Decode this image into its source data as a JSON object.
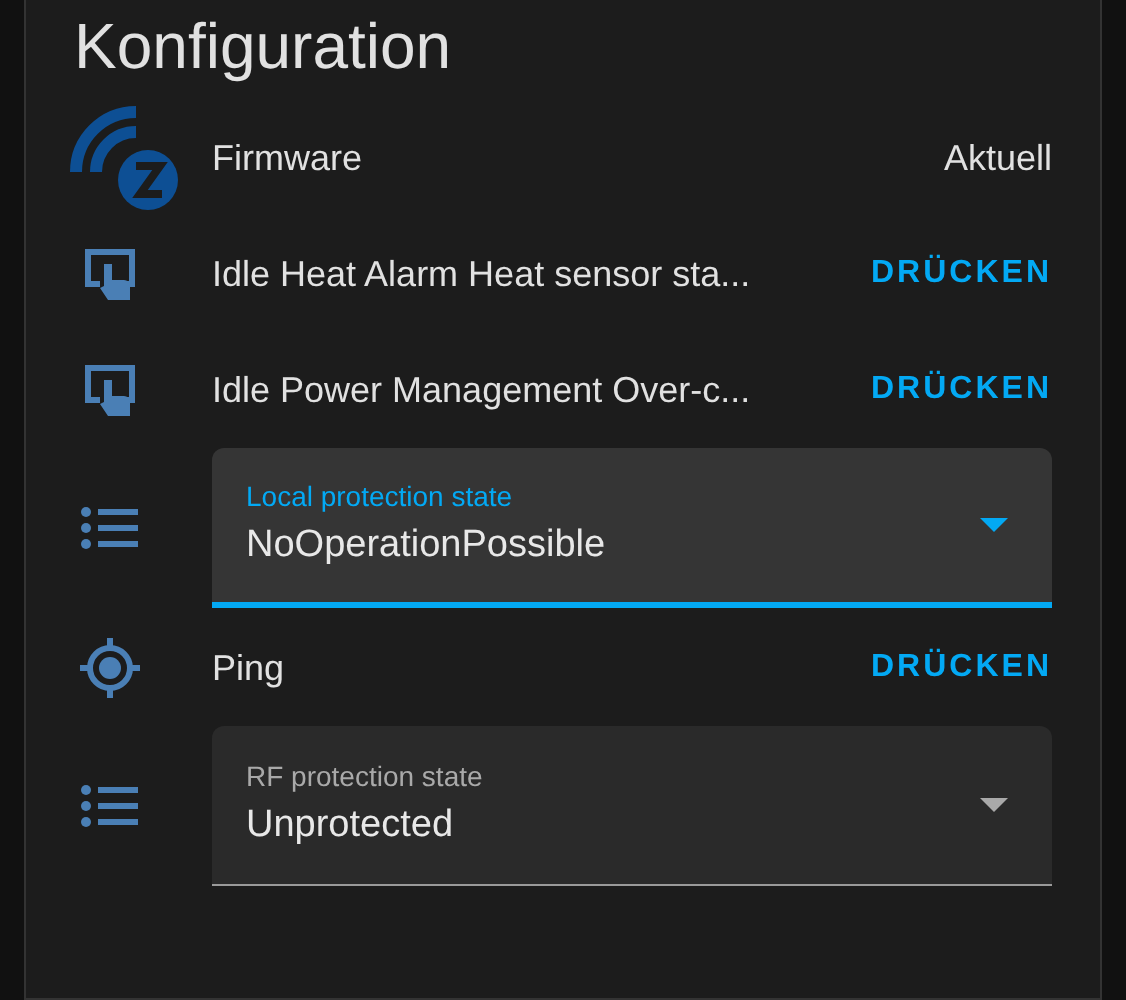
{
  "card": {
    "title": "Konfiguration"
  },
  "rows": [
    {
      "kind": "firmware",
      "label": "Firmware",
      "value": "Aktuell"
    },
    {
      "kind": "press",
      "label": "Idle Heat Alarm Heat sensor sta...",
      "action": "DRÜCKEN"
    },
    {
      "kind": "press",
      "label": "Idle Power Management Over-c...",
      "action": "DRÜCKEN"
    },
    {
      "kind": "select",
      "label": "Local protection state",
      "value": "NoOperationPossible",
      "focused": true
    },
    {
      "kind": "ping",
      "label": "Ping",
      "action": "DRÜCKEN"
    },
    {
      "kind": "select",
      "label": "RF protection state",
      "value": "Unprotected",
      "focused": false
    }
  ]
}
